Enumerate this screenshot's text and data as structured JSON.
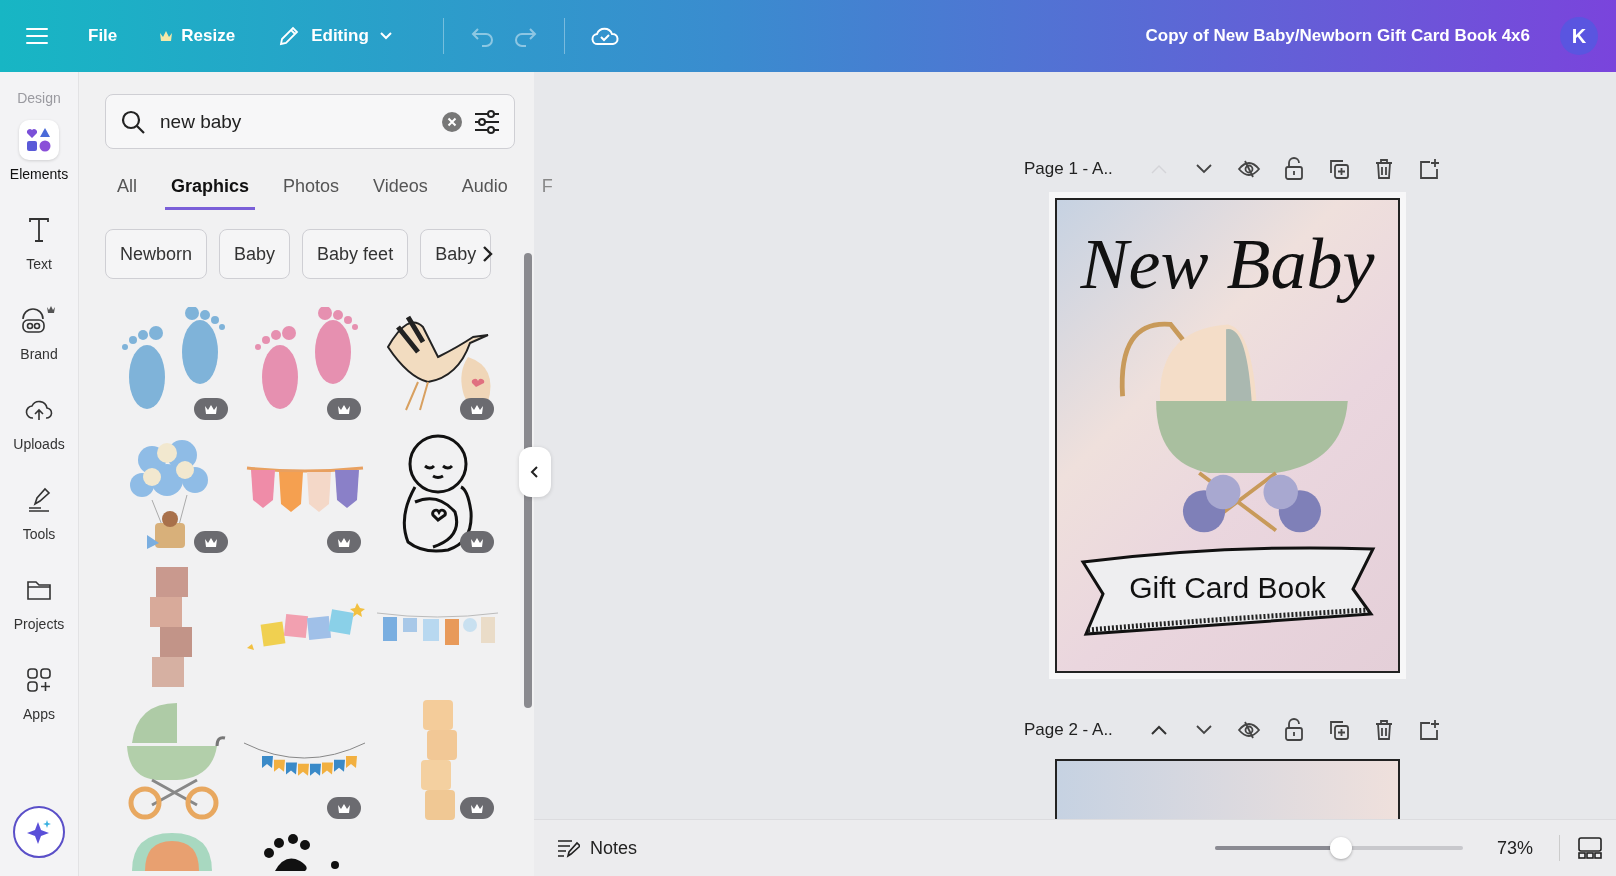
{
  "topbar": {
    "menu": "File",
    "resize": "Resize",
    "mode": "Editing",
    "undo_disabled": true,
    "redo_disabled": true,
    "title": "Copy of New Baby/Newborn Gift Card Book 4x6",
    "avatar": "K"
  },
  "rail": {
    "heading": "Design",
    "items": [
      {
        "kind": "elements",
        "label": "Elements",
        "selected": true
      },
      {
        "kind": "text",
        "label": "Text",
        "selected": false
      },
      {
        "kind": "brand",
        "label": "Brand",
        "selected": false
      },
      {
        "kind": "uploads",
        "label": "Uploads",
        "selected": false
      },
      {
        "kind": "tools",
        "label": "Tools",
        "selected": false
      },
      {
        "kind": "projects",
        "label": "Projects",
        "selected": false
      },
      {
        "kind": "apps",
        "label": "Apps",
        "selected": false
      }
    ]
  },
  "panel": {
    "search": {
      "value": "new baby"
    },
    "tabs": [
      {
        "label": "All",
        "selected": false
      },
      {
        "label": "Graphics",
        "selected": true
      },
      {
        "label": "Photos",
        "selected": false
      },
      {
        "label": "Videos",
        "selected": false
      },
      {
        "label": "Audio",
        "selected": false
      },
      {
        "label": "F",
        "selected": false
      }
    ],
    "chips": [
      "Newborn",
      "Baby",
      "Baby feet",
      "Baby"
    ],
    "graphics": [
      {
        "kind": "feet-blue",
        "premium": true
      },
      {
        "kind": "feet-pink",
        "premium": true
      },
      {
        "kind": "stork",
        "premium": true
      },
      {
        "kind": "balloon",
        "premium": true
      },
      {
        "kind": "bunting",
        "premium": true
      },
      {
        "kind": "swaddle",
        "premium": true
      },
      {
        "kind": "blocks",
        "premium": false
      },
      {
        "kind": "block-garland",
        "premium": false
      },
      {
        "kind": "clothesline",
        "premium": false
      },
      {
        "kind": "pram",
        "premium": false
      },
      {
        "kind": "flag-garland",
        "premium": true
      },
      {
        "kind": "blocks-tall",
        "premium": true
      },
      {
        "kind": "baby-face",
        "premium": false
      },
      {
        "kind": "paw",
        "premium": false
      }
    ]
  },
  "pages": [
    {
      "label": "Page 1 - A..",
      "up_disabled": true
    },
    {
      "label": "Page 2 - A..",
      "up_disabled": false
    }
  ],
  "design": {
    "title": "New Baby",
    "banner": "Gift Card Book"
  },
  "footer": {
    "notes": "Notes",
    "zoom": {
      "level": 0.51,
      "reading": "73%"
    }
  }
}
